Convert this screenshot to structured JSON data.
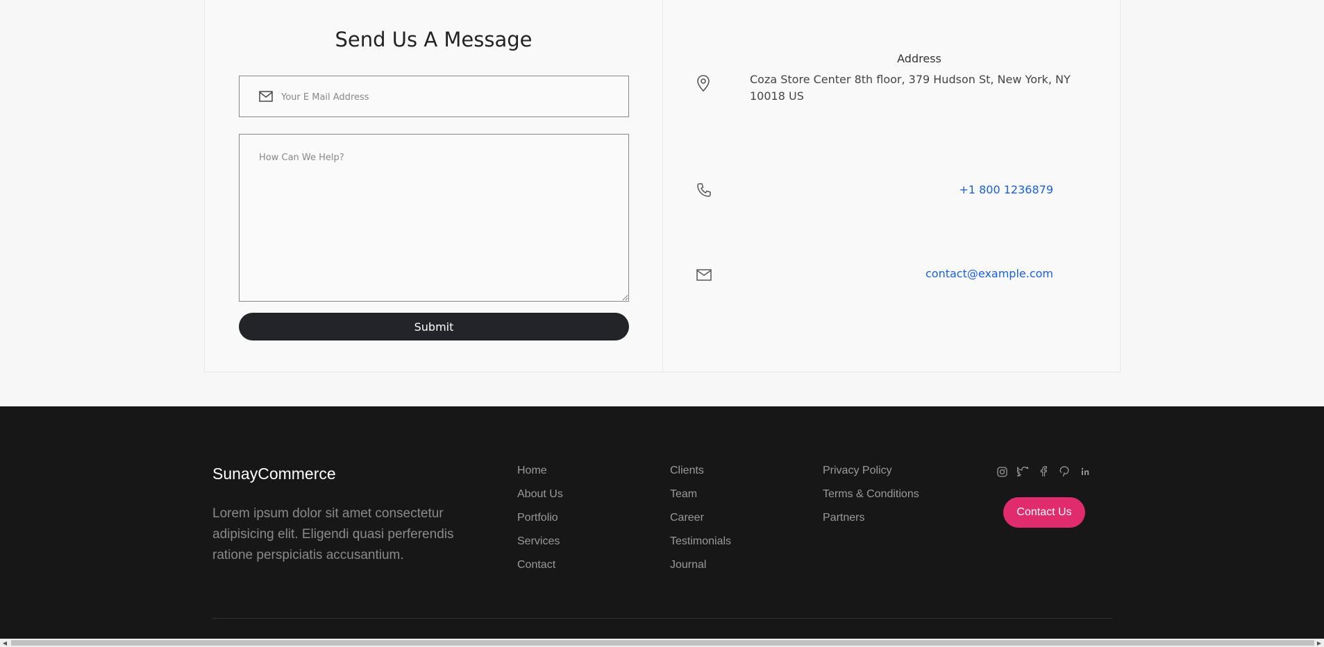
{
  "form": {
    "title": "Send Us A Message",
    "email_placeholder": "Your E Mail Address",
    "message_placeholder": "How Can We Help?",
    "submit_label": "Submit"
  },
  "info": {
    "address_title": "Address",
    "address_text": "Coza Store Center 8th floor, 379 Hudson St, New York, NY 10018 US",
    "phone": "+1 800 1236879",
    "email": "contact@example.com"
  },
  "footer": {
    "brand": "SunayCommerce",
    "about": "Lorem ipsum dolor sit amet consectetur adipisicing elit. Eligendi quasi perferendis ratione perspiciatis accusantium.",
    "col1": [
      "Home",
      "About Us",
      "Portfolio",
      "Services",
      "Contact"
    ],
    "col2": [
      "Clients",
      "Team",
      "Career",
      "Testimonials",
      "Journal"
    ],
    "col3": [
      "Privacy Policy",
      "Terms & Conditions",
      "Partners"
    ],
    "social_icons": [
      "instagram-icon",
      "twitter-icon",
      "facebook-icon",
      "pinterest-icon",
      "linkedin-icon"
    ],
    "contact_label": "Contact Us",
    "accent": "#e02c6d"
  }
}
